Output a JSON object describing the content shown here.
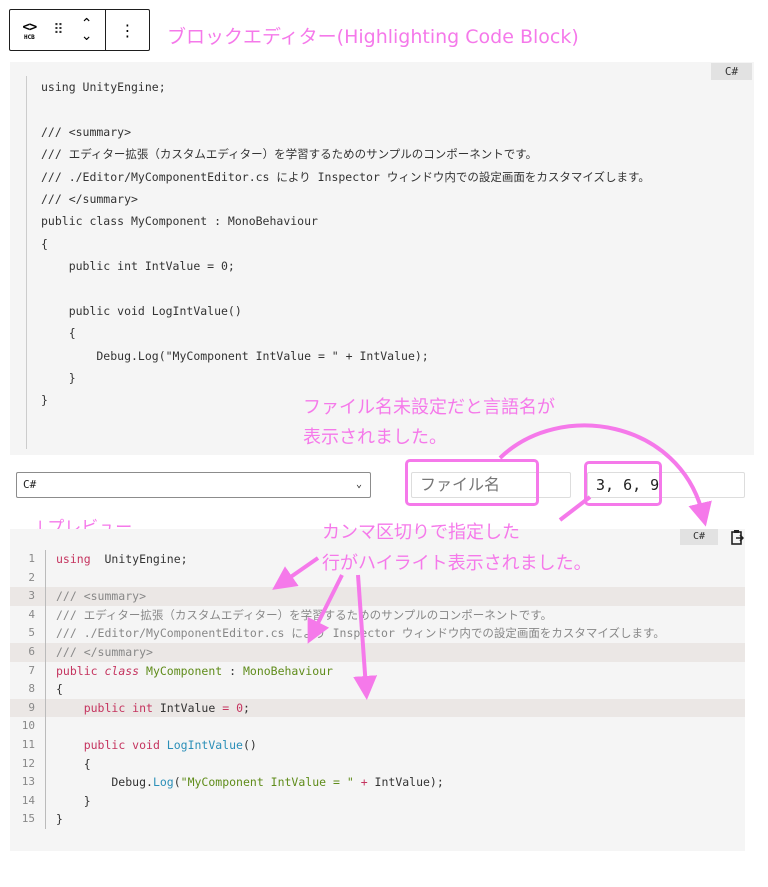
{
  "toolbar": {
    "hcb_top": "<>",
    "hcb_bottom": "HCB",
    "drag": "⠿",
    "up": "⌃",
    "down": "⌄",
    "more": "⋮"
  },
  "annotations": {
    "title": "ブロックエディター(Highlighting Code Block)",
    "filename_note_1": "ファイル名未設定だと言語名が",
    "filename_note_2": "表示されました。",
    "preview_label": "↓プレビュー",
    "highlight_note_1": "カンマ区切りで指定した",
    "highlight_note_2": "行がハイライト表示されました。",
    "accent_color": "#f579ea"
  },
  "editor": {
    "lang_badge": "C#",
    "lines": [
      "using UnityEngine;",
      "",
      "/// <summary>",
      "/// エディター拡張（カスタムエディター）を学習するためのサンプルのコンポーネントです。",
      "/// ./Editor/MyComponentEditor.cs により Inspector ウィンドウ内での設定画面をカスタマイズします。",
      "/// </summary>",
      "public class MyComponent : MonoBehaviour",
      "{",
      "    public int IntValue = 0;",
      "",
      "    public void LogIntValue()",
      "    {",
      "        Debug.Log(\"MyComponent IntValue = \" + IntValue);",
      "    }",
      "}"
    ]
  },
  "settings": {
    "language": "C#",
    "filename_placeholder": "ファイル名",
    "highlight_lines": "3, 6, 9"
  },
  "preview": {
    "lang_badge": "C#",
    "copy_icon": "copy-icon",
    "highlighted": [
      3,
      6,
      9
    ],
    "lines": [
      [
        [
          "kw",
          "using"
        ],
        [
          "",
          "  UnityEngine;"
        ]
      ],
      [],
      [
        [
          "cm",
          "/// <summary>"
        ]
      ],
      [
        [
          "cm",
          "/// エディター拡張（カスタムエディター）を学習するためのサンプルのコンポーネントです。"
        ]
      ],
      [
        [
          "cm",
          "/// ./Editor/MyComponentEditor.cs により Inspector ウィンドウ内での設定画面をカスタマイズします。"
        ]
      ],
      [
        [
          "cm",
          "/// </summary>"
        ]
      ],
      [
        [
          "kw",
          "public "
        ],
        [
          "kwi",
          "class "
        ],
        [
          "cls",
          "MyComponent"
        ],
        [
          "",
          " : "
        ],
        [
          "cls",
          "MonoBehaviour"
        ]
      ],
      [
        [
          "",
          "{"
        ]
      ],
      [
        [
          "",
          "    "
        ],
        [
          "kw",
          "public int "
        ],
        [
          "",
          "IntValue "
        ],
        [
          "op",
          "="
        ],
        [
          "",
          " "
        ],
        [
          "num",
          "0"
        ],
        [
          "",
          ";"
        ]
      ],
      [],
      [
        [
          "",
          "    "
        ],
        [
          "kw",
          "public void "
        ],
        [
          "fn",
          "LogIntValue"
        ],
        [
          "",
          "()"
        ]
      ],
      [
        [
          "",
          "    {"
        ]
      ],
      [
        [
          "",
          "        Debug."
        ],
        [
          "fn",
          "Log"
        ],
        [
          "",
          "("
        ],
        [
          "str",
          "\"MyComponent IntValue = \""
        ],
        [
          "",
          " "
        ],
        [
          "op",
          "+"
        ],
        [
          "",
          " IntValue);"
        ]
      ],
      [
        [
          "",
          "    }"
        ]
      ],
      [
        [
          "",
          "}"
        ]
      ]
    ]
  }
}
